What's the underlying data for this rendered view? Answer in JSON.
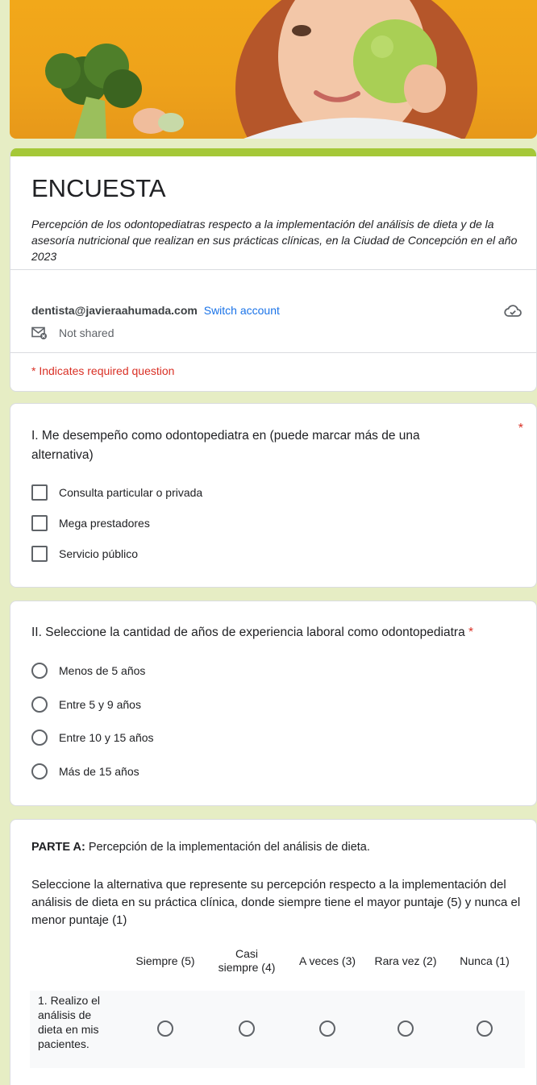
{
  "form": {
    "title": "ENCUESTA",
    "description": "Percepción de los odontopediatras respecto a la implementación del análisis de dieta y de la asesoría nutricional que realizan en sus prácticas clínicas, en la Ciudad de Concepción en el año 2023",
    "account_email": "dentista@javieraahumada.com",
    "switch_account": "Switch account",
    "not_shared": "Not shared",
    "required_note": "* Indicates required question"
  },
  "q1": {
    "title": "I. Me desempeño como odontopediatra en (puede marcar más de una alternativa)",
    "required": "*",
    "options": [
      "Consulta particular o privada",
      "Mega prestadores",
      "Servicio público"
    ]
  },
  "q2": {
    "title": "II. Seleccione la cantidad de años de experiencia laboral como odontopediatra",
    "required": "*",
    "options": [
      "Menos de 5 años",
      "Entre 5 y 9 años",
      "Entre 10 y 15 años",
      "Más de 15 años"
    ]
  },
  "q3": {
    "parte_bold": "PARTE A:",
    "parte_rest": " Percepción de la implementación del análisis de dieta.",
    "instructions": "Seleccione la alternativa que represente su percepción respecto a la implementación del análisis de dieta en su práctica clínica, donde siempre tiene el mayor puntaje (5) y nunca el menor puntaje (1)",
    "columns": [
      "Siempre (5)",
      "Casi siempre (4)",
      "A veces (3)",
      "Rara vez (2)",
      "Nunca (1)"
    ],
    "rows": [
      "1. Realizo el análisis de dieta en mis pacientes."
    ]
  },
  "colors": {
    "page_background": "#e6edc4",
    "accent_bar": "#a5c838",
    "link": "#1a73e8",
    "required": "#d93025",
    "banner": "#eea21a"
  }
}
